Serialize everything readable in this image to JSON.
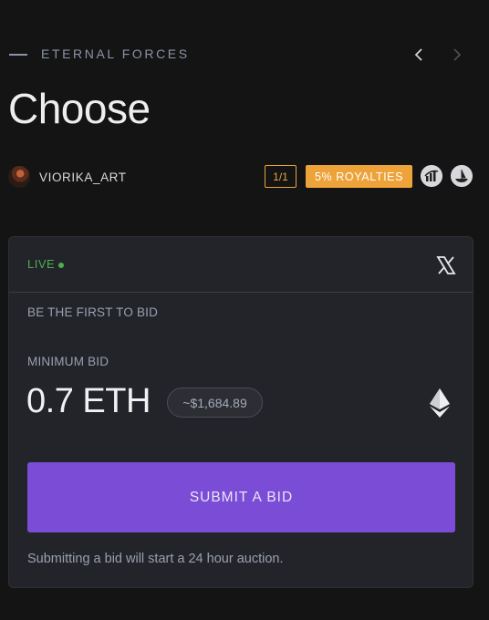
{
  "header": {
    "collection": "ETERNAL FORCES",
    "title": "Choose",
    "nav": {
      "prev_icon": "chevron-left-icon",
      "next_icon": "chevron-right-icon"
    }
  },
  "artist": {
    "name": "VIORIKA_ART",
    "edition": "1/1",
    "royalties": "5% ROYALTIES",
    "marketplaces": [
      "rarible-icon",
      "opensea-icon"
    ]
  },
  "auction": {
    "status": "LIVE",
    "share_icon": "x-logo-icon",
    "first_bid_text": "BE THE FIRST TO BID",
    "min_bid_label": "MINIMUM BID",
    "min_bid_value": "0.7 ETH",
    "usd_value": "~$1,684.89",
    "currency_icon": "ethereum-icon",
    "submit_label": "SUBMIT A BID",
    "note": "Submitting a bid will start a 24 hour auction."
  },
  "colors": {
    "background": "#141414",
    "card": "#222429",
    "accent_purple": "#7b4dd6",
    "royalty_orange": "#eda339",
    "live_green": "#4caf50"
  }
}
